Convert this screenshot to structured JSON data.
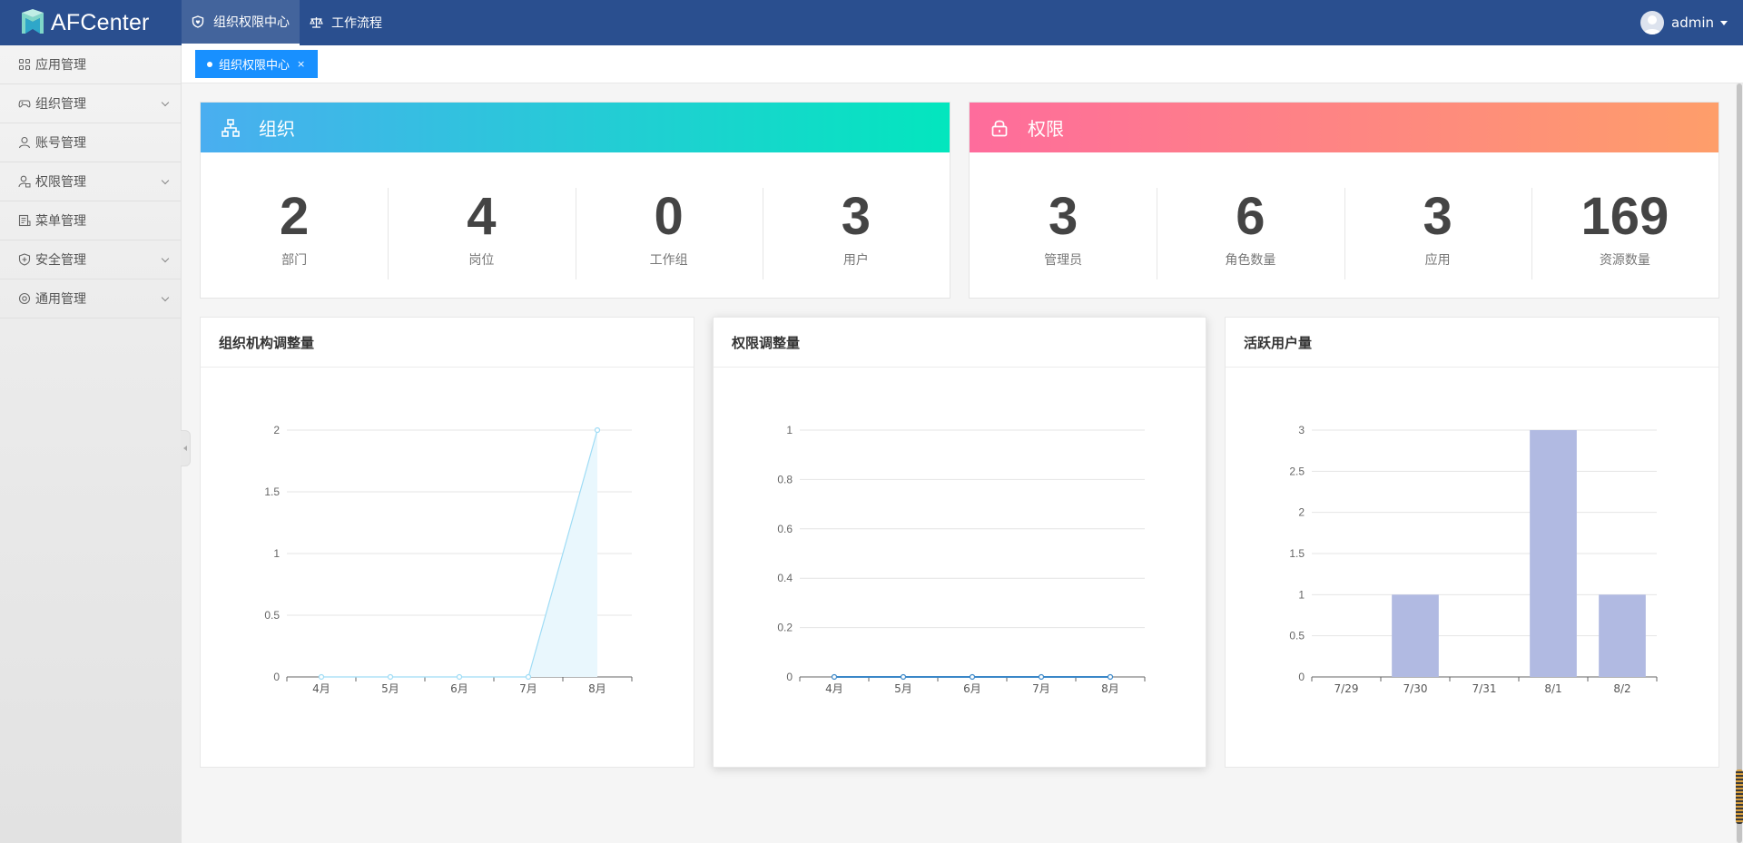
{
  "app": {
    "logo_text": "AFCenter"
  },
  "topnav": [
    {
      "label": "组织权限中心",
      "icon": "shield-heart-icon",
      "active": true
    },
    {
      "label": "工作流程",
      "icon": "scale-icon",
      "active": false
    }
  ],
  "user": {
    "name": "admin"
  },
  "sidebar": {
    "items": [
      {
        "label": "应用管理",
        "icon": "apps-grid-icon",
        "expandable": false
      },
      {
        "label": "组织管理",
        "icon": "gamepad-icon",
        "expandable": true
      },
      {
        "label": "账号管理",
        "icon": "user-icon",
        "expandable": false
      },
      {
        "label": "权限管理",
        "icon": "user-lock-icon",
        "expandable": true
      },
      {
        "label": "菜单管理",
        "icon": "menu-doc-icon",
        "expandable": false
      },
      {
        "label": "安全管理",
        "icon": "shield-plus-icon",
        "expandable": true
      },
      {
        "label": "通用管理",
        "icon": "settings-circle-icon",
        "expandable": true
      }
    ]
  },
  "tabs": [
    {
      "label": "组织权限中心",
      "close": "×"
    }
  ],
  "org_card": {
    "title": "组织",
    "icon": "org-tree-icon",
    "gradient": [
      "#4aaef0",
      "#03e6be"
    ],
    "stats": [
      {
        "value": "2",
        "label": "部门"
      },
      {
        "value": "4",
        "label": "岗位"
      },
      {
        "value": "0",
        "label": "工作组"
      },
      {
        "value": "3",
        "label": "用户"
      }
    ]
  },
  "perm_card": {
    "title": "权限",
    "icon": "lock-icon",
    "gradient": [
      "#fe6c9c",
      "#fe9e6a"
    ],
    "stats": [
      {
        "value": "3",
        "label": "管理员"
      },
      {
        "value": "6",
        "label": "角色数量"
      },
      {
        "value": "3",
        "label": "应用"
      },
      {
        "value": "169",
        "label": "资源数量"
      }
    ]
  },
  "chart_data": [
    {
      "title": "组织机构调整量",
      "type": "area",
      "categories": [
        "4月",
        "5月",
        "6月",
        "7月",
        "8月"
      ],
      "values": [
        0,
        0,
        0,
        0,
        2
      ],
      "yticks": [
        "0",
        "0.5",
        "1",
        "1.5",
        "2"
      ],
      "ylim": [
        0,
        2
      ],
      "color": "#9fdcf5"
    },
    {
      "title": "权限调整量",
      "type": "line",
      "categories": [
        "4月",
        "5月",
        "6月",
        "7月",
        "8月"
      ],
      "values": [
        0,
        0,
        0,
        0,
        0
      ],
      "yticks": [
        "0",
        "0.2",
        "0.4",
        "0.6",
        "0.8",
        "1"
      ],
      "ylim": [
        0,
        1
      ],
      "color": "#3a87c8"
    },
    {
      "title": "活跃用户量",
      "type": "bar",
      "categories": [
        "7/29",
        "7/30",
        "7/31",
        "8/1",
        "8/2"
      ],
      "values": [
        0,
        1,
        0,
        3,
        1
      ],
      "yticks": [
        "0",
        "0.5",
        "1",
        "1.5",
        "2",
        "2.5",
        "3"
      ],
      "ylim": [
        0,
        3
      ],
      "color": "#b1bae2"
    }
  ]
}
